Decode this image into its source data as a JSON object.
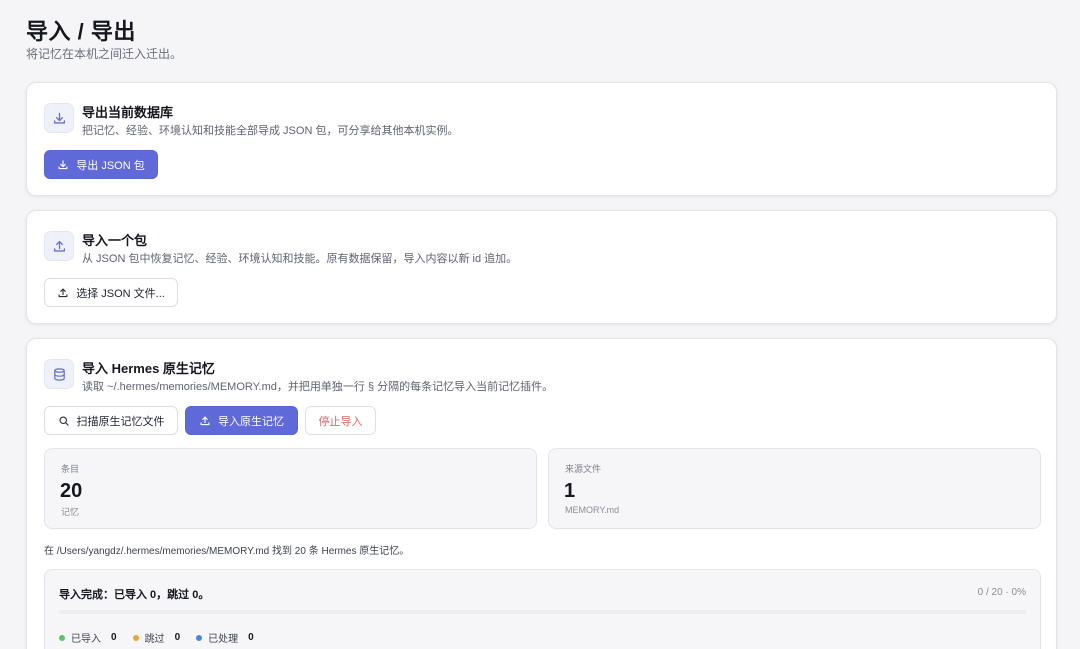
{
  "page": {
    "title": "导入 / 导出",
    "subtitle": "将记忆在本机之间迁入迁出。"
  },
  "export_card": {
    "icon": "download-icon",
    "title": "导出当前数据库",
    "description": "把记忆、经验、环境认知和技能全部导成 JSON 包，可分享给其他本机实例。",
    "button_label": "导出 JSON 包"
  },
  "import_card": {
    "icon": "upload-icon",
    "title": "导入一个包",
    "description": "从 JSON 包中恢复记忆、经验、环境认知和技能。原有数据保留，导入内容以新 id 追加。",
    "button_label": "选择 JSON 文件..."
  },
  "hermes_card": {
    "icon": "database-icon",
    "title": "导入 Hermes 原生记忆",
    "description": "读取 ~/.hermes/memories/MEMORY.md，并把用单独一行 § 分隔的每条记忆导入当前记忆插件。",
    "buttons": {
      "scan_label": "扫描原生记忆文件",
      "import_label": "导入原生记忆",
      "stop_label": "停止导入"
    },
    "stats": [
      {
        "label": "条目",
        "value": "20",
        "unit": "记忆"
      },
      {
        "label": "来源文件",
        "value": "1",
        "unit": "MEMORY.md"
      }
    ],
    "found_message": "在 /Users/yangdz/.hermes/memories/MEMORY.md 找到 20 条 Hermes 原生记忆。",
    "progress": {
      "status": "导入完成：已导入 0，跳过 0。",
      "count_text": "0 / 20 · 0%",
      "fraction": 0,
      "legend": [
        {
          "label": "已导入",
          "value": "0",
          "color": "#5cc36a"
        },
        {
          "label": "跳过",
          "value": "0",
          "color": "#eda23e"
        },
        {
          "label": "已处理",
          "value": "0",
          "color": "#4a86e0"
        }
      ]
    }
  },
  "colors": {
    "accent": "#5f6ad8",
    "danger": "#e06a6a"
  }
}
